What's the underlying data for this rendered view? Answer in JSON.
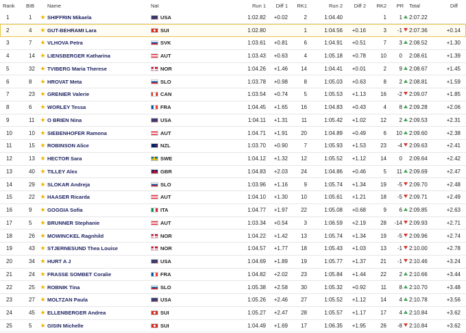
{
  "headers": {
    "rank": "Rank",
    "bib": "BIB",
    "name": "Name",
    "nat": "Nat",
    "run1": "Run 1",
    "diff1": "Diff 1",
    "rk1": "RK1",
    "run2": "Run 2",
    "diff2": "Diff 2",
    "rk2": "RK2",
    "pr": "PR",
    "total": "Total",
    "diff": "Diff"
  },
  "colors": {
    "star": "#f0b400",
    "name": "#1a1f5e",
    "up": "#3aa655",
    "down": "#d9312b",
    "highlight": "#e8c547"
  },
  "rows": [
    {
      "rank": "1",
      "bib": "1",
      "name": "SHIFFRIN Mikaela",
      "nat": "USA",
      "flag": "flag-usa",
      "run1": "1:02.82",
      "diff1": "+0.02",
      "rk1": "2",
      "run2": "1:04.40",
      "diff2": "",
      "rk2": "1",
      "pr": "1",
      "trend": "up",
      "total": "2:07.22",
      "diff": ""
    },
    {
      "rank": "2",
      "bib": "4",
      "name": "GUT-BEHRAMI Lara",
      "nat": "SUI",
      "flag": "flag-sui",
      "run1": "1:02.80",
      "diff1": "",
      "rk1": "1",
      "run2": "1:04.56",
      "diff2": "+0.16",
      "rk2": "3",
      "pr": "-1",
      "trend": "down",
      "total": "2:07.36",
      "diff": "+0.14",
      "highlight": true
    },
    {
      "rank": "3",
      "bib": "7",
      "name": "VLHOVA Petra",
      "nat": "SVK",
      "flag": "flag-svk",
      "run1": "1:03.61",
      "diff1": "+0.81",
      "rk1": "6",
      "run2": "1:04.91",
      "diff2": "+0.51",
      "rk2": "7",
      "pr": "3",
      "trend": "up",
      "total": "2:08.52",
      "diff": "+1.30"
    },
    {
      "rank": "4",
      "bib": "14",
      "name": "LIENSBERGER Katharina",
      "nat": "AUT",
      "flag": "flag-aut",
      "run1": "1:03.43",
      "diff1": "+0.63",
      "rk1": "4",
      "run2": "1:05.18",
      "diff2": "+0.78",
      "rk2": "10",
      "pr": "0",
      "trend": "same",
      "total": "2:08.61",
      "diff": "+1.39"
    },
    {
      "rank": "5",
      "bib": "32",
      "name": "TVIBERG Maria Therese",
      "nat": "NOR",
      "flag": "flag-nor",
      "run1": "1:04.26",
      "diff1": "+1.46",
      "rk1": "14",
      "run2": "1:04.41",
      "diff2": "+0.01",
      "rk2": "2",
      "pr": "9",
      "trend": "up",
      "total": "2:08.67",
      "diff": "+1.45"
    },
    {
      "rank": "6",
      "bib": "8",
      "name": "HROVAT Meta",
      "nat": "SLO",
      "flag": "flag-slo",
      "run1": "1:03.78",
      "diff1": "+0.98",
      "rk1": "8",
      "run2": "1:05.03",
      "diff2": "+0.63",
      "rk2": "8",
      "pr": "2",
      "trend": "up",
      "total": "2:08.81",
      "diff": "+1.59"
    },
    {
      "rank": "7",
      "bib": "23",
      "name": "GRENIER Valerie",
      "nat": "CAN",
      "flag": "flag-can",
      "run1": "1:03.54",
      "diff1": "+0.74",
      "rk1": "5",
      "run2": "1:05.53",
      "diff2": "+1.13",
      "rk2": "16",
      "pr": "-2",
      "trend": "down",
      "total": "2:09.07",
      "diff": "+1.85"
    },
    {
      "rank": "8",
      "bib": "6",
      "name": "WORLEY Tessa",
      "nat": "FRA",
      "flag": "flag-fra",
      "run1": "1:04.45",
      "diff1": "+1.65",
      "rk1": "16",
      "run2": "1:04.83",
      "diff2": "+0.43",
      "rk2": "4",
      "pr": "8",
      "trend": "up",
      "total": "2:09.28",
      "diff": "+2.06"
    },
    {
      "rank": "9",
      "bib": "11",
      "name": "O BRIEN Nina",
      "nat": "USA",
      "flag": "flag-usa",
      "run1": "1:04.11",
      "diff1": "+1.31",
      "rk1": "11",
      "run2": "1:05.42",
      "diff2": "+1.02",
      "rk2": "12",
      "pr": "2",
      "trend": "up",
      "total": "2:09.53",
      "diff": "+2.31"
    },
    {
      "rank": "10",
      "bib": "10",
      "name": "SIEBENHOFER Ramona",
      "nat": "AUT",
      "flag": "flag-aut",
      "run1": "1:04.71",
      "diff1": "+1.91",
      "rk1": "20",
      "run2": "1:04.89",
      "diff2": "+0.49",
      "rk2": "6",
      "pr": "10",
      "trend": "up",
      "total": "2:09.60",
      "diff": "+2.38"
    },
    {
      "rank": "11",
      "bib": "15",
      "name": "ROBINSON Alice",
      "nat": "NZL",
      "flag": "flag-nzl",
      "run1": "1:03.70",
      "diff1": "+0.90",
      "rk1": "7",
      "run2": "1:05.93",
      "diff2": "+1.53",
      "rk2": "23",
      "pr": "-4",
      "trend": "down",
      "total": "2:09.63",
      "diff": "+2.41"
    },
    {
      "rank": "12",
      "bib": "13",
      "name": "HECTOR Sara",
      "nat": "SWE",
      "flag": "flag-swe",
      "run1": "1:04.12",
      "diff1": "+1.32",
      "rk1": "12",
      "run2": "1:05.52",
      "diff2": "+1.12",
      "rk2": "14",
      "pr": "0",
      "trend": "same",
      "total": "2:09.64",
      "diff": "+2.42"
    },
    {
      "rank": "13",
      "bib": "40",
      "name": "TILLEY Alex",
      "nat": "GBR",
      "flag": "flag-gbr",
      "run1": "1:04.83",
      "diff1": "+2.03",
      "rk1": "24",
      "run2": "1:04.86",
      "diff2": "+0.46",
      "rk2": "5",
      "pr": "11",
      "trend": "up",
      "total": "2:09.69",
      "diff": "+2.47"
    },
    {
      "rank": "14",
      "bib": "29",
      "name": "SLOKAR Andreja",
      "nat": "SLO",
      "flag": "flag-slo",
      "run1": "1:03.96",
      "diff1": "+1.16",
      "rk1": "9",
      "run2": "1:05.74",
      "diff2": "+1.34",
      "rk2": "19",
      "pr": "-5",
      "trend": "down",
      "total": "2:09.70",
      "diff": "+2.48"
    },
    {
      "rank": "15",
      "bib": "22",
      "name": "HAASER Ricarda",
      "nat": "AUT",
      "flag": "flag-aut",
      "run1": "1:04.10",
      "diff1": "+1.30",
      "rk1": "10",
      "run2": "1:05.61",
      "diff2": "+1.21",
      "rk2": "18",
      "pr": "-5",
      "trend": "down",
      "total": "2:09.71",
      "diff": "+2.49"
    },
    {
      "rank": "16",
      "bib": "9",
      "name": "GOGGIA Sofia",
      "nat": "ITA",
      "flag": "flag-ita",
      "run1": "1:04.77",
      "diff1": "+1.97",
      "rk1": "22",
      "run2": "1:05.08",
      "diff2": "+0.68",
      "rk2": "9",
      "pr": "6",
      "trend": "up",
      "total": "2:09.85",
      "diff": "+2.63"
    },
    {
      "rank": "17",
      "bib": "5",
      "name": "BRUNNER Stephanie",
      "nat": "AUT",
      "flag": "flag-aut",
      "run1": "1:03.34",
      "diff1": "+0.54",
      "rk1": "3",
      "run2": "1:06.59",
      "diff2": "+2.19",
      "rk2": "28",
      "pr": "-14",
      "trend": "down",
      "total": "2:09.93",
      "diff": "+2.71"
    },
    {
      "rank": "18",
      "bib": "26",
      "name": "MOWINCKEL Ragnhild",
      "nat": "NOR",
      "flag": "flag-nor",
      "run1": "1:04.22",
      "diff1": "+1.42",
      "rk1": "13",
      "run2": "1:05.74",
      "diff2": "+1.34",
      "rk2": "19",
      "pr": "-5",
      "trend": "down",
      "total": "2:09.96",
      "diff": "+2.74"
    },
    {
      "rank": "19",
      "bib": "43",
      "name": "STJERNESUND Thea Louise",
      "nat": "NOR",
      "flag": "flag-nor",
      "run1": "1:04.57",
      "diff1": "+1.77",
      "rk1": "18",
      "run2": "1:05.43",
      "diff2": "+1.03",
      "rk2": "13",
      "pr": "-1",
      "trend": "down",
      "total": "2:10.00",
      "diff": "+2.78"
    },
    {
      "rank": "20",
      "bib": "34",
      "name": "HURT A J",
      "nat": "USA",
      "flag": "flag-usa",
      "run1": "1:04.69",
      "diff1": "+1.89",
      "rk1": "19",
      "run2": "1:05.77",
      "diff2": "+1.37",
      "rk2": "21",
      "pr": "-1",
      "trend": "down",
      "total": "2:10.46",
      "diff": "+3.24"
    },
    {
      "rank": "21",
      "bib": "24",
      "name": "FRASSE SOMBET Coralie",
      "nat": "FRA",
      "flag": "flag-fra",
      "run1": "1:04.82",
      "diff1": "+2.02",
      "rk1": "23",
      "run2": "1:05.84",
      "diff2": "+1.44",
      "rk2": "22",
      "pr": "2",
      "trend": "up",
      "total": "2:10.66",
      "diff": "+3.44"
    },
    {
      "rank": "22",
      "bib": "25",
      "name": "ROBNIK Tina",
      "nat": "SLO",
      "flag": "flag-slo",
      "run1": "1:05.38",
      "diff1": "+2.58",
      "rk1": "30",
      "run2": "1:05.32",
      "diff2": "+0.92",
      "rk2": "11",
      "pr": "8",
      "trend": "up",
      "total": "2:10.70",
      "diff": "+3.48"
    },
    {
      "rank": "23",
      "bib": "27",
      "name": "MOLTZAN Paula",
      "nat": "USA",
      "flag": "flag-usa",
      "run1": "1:05.26",
      "diff1": "+2.46",
      "rk1": "27",
      "run2": "1:05.52",
      "diff2": "+1.12",
      "rk2": "14",
      "pr": "4",
      "trend": "up",
      "total": "2:10.78",
      "diff": "+3.56"
    },
    {
      "rank": "24",
      "bib": "45",
      "name": "ELLENBERGER Andrea",
      "nat": "SUI",
      "flag": "flag-sui",
      "run1": "1:05.27",
      "diff1": "+2.47",
      "rk1": "28",
      "run2": "1:05.57",
      "diff2": "+1.17",
      "rk2": "17",
      "pr": "4",
      "trend": "up",
      "total": "2:10.84",
      "diff": "+3.62"
    },
    {
      "rank": "25",
      "bib": "5",
      "name": "GISIN Michelle",
      "nat": "SUI",
      "flag": "flag-sui",
      "run1": "1:04.49",
      "diff1": "+1.69",
      "rk1": "17",
      "run2": "1:06.35",
      "diff2": "+1.95",
      "rk2": "26",
      "pr": "-8",
      "trend": "down",
      "total": "2:10.84",
      "diff": "+3.62"
    }
  ]
}
